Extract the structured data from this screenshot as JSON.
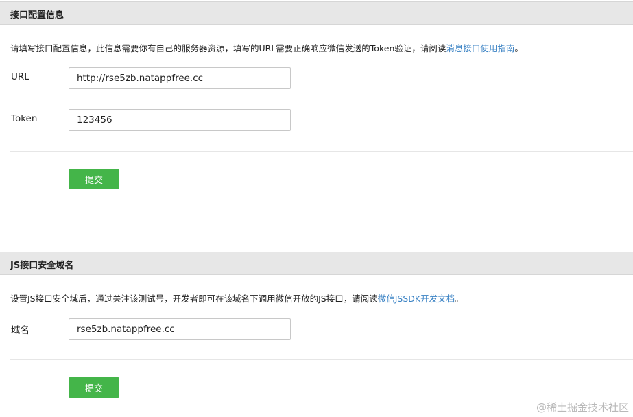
{
  "interface_config": {
    "title": "接口配置信息",
    "description": "请填写接口配置信息，此信息需要你有自己的服务器资源，填写的URL需要正确响应微信发送的Token验证，请阅读",
    "link": "消息接口使用指南",
    "desc_end": "。",
    "url_label": "URL",
    "url_value": "http://rse5zb.natappfree.cc",
    "token_label": "Token",
    "token_value": "123456",
    "submit_label": "提交"
  },
  "js_config": {
    "title": "JS接口安全域名",
    "description": "设置JS接口安全域后，通过关注该测试号，开发者即可在该域名下调用微信开放的JS接口，请阅读",
    "link": "微信JSSDK开发文档",
    "desc_end": "。",
    "domain_label": "域名",
    "domain_value": "rse5zb.natappfree.cc",
    "submit_label": "提交"
  },
  "watermark": "@稀土掘金技术社区",
  "colors": {
    "accent_button": "#44b549",
    "link": "#3a82c4",
    "header_bg": "#e7e7e7"
  }
}
